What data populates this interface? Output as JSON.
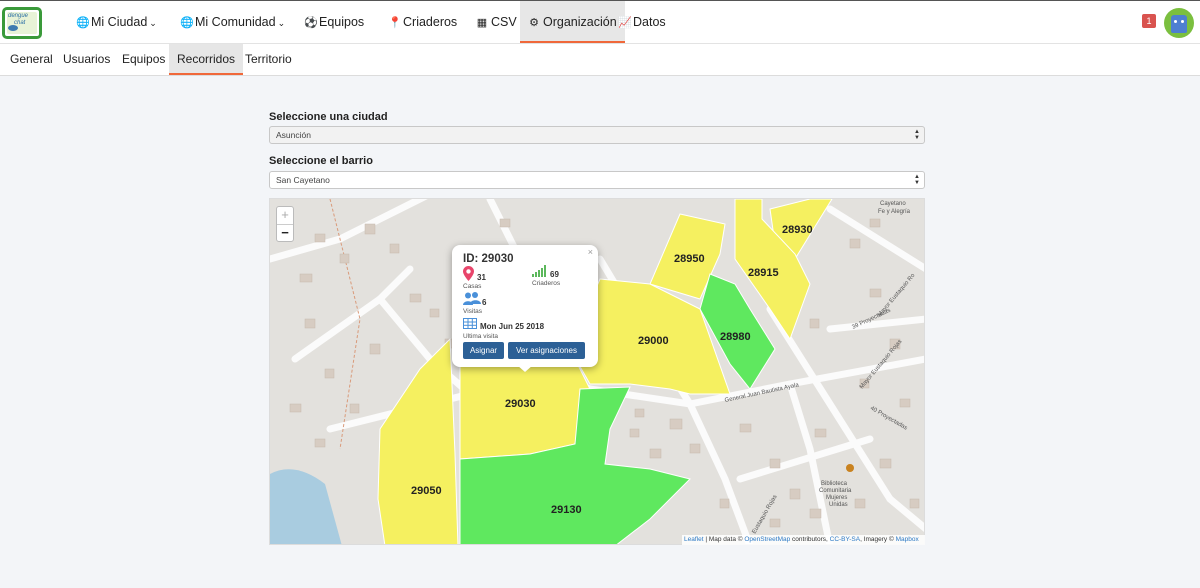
{
  "app": {
    "logo_line1": "dengue",
    "logo_line2": "chat"
  },
  "nav": {
    "mi_ciudad": "Mi Ciudad",
    "mi_comunidad": "Mi Comunidad",
    "equipos": "Equipos",
    "criaderos": "Criaderos",
    "csv": "CSV",
    "organizacion": "Organización",
    "datos": "Datos",
    "notification_count": "1"
  },
  "subnav": {
    "general": "General",
    "usuarios": "Usuarios",
    "equipos": "Equipos",
    "recorridos": "Recorridos",
    "territorio": "Territorio"
  },
  "form": {
    "city_label": "Seleccione una ciudad",
    "city_value": "Asunción",
    "barrio_label": "Seleccione el barrio",
    "barrio_value": "San Cayetano"
  },
  "map": {
    "zoom_in": "+",
    "zoom_out": "−",
    "streets": {
      "general_juan": "General Juan Bautista Ayala",
      "proyectadas_39": "39 Proyectadas",
      "mayor_eustaquio_1": "Mayor Eustaquio Ro",
      "mayor_eustaquio_2": "Mayor Eustaquio Rojas",
      "proyectadas_40": "40 Proyectadas",
      "eustaquio_rojas": "Eustaquio Rojas",
      "cayetano": "Cayetano",
      "fe_y_alegria": "Fe y Alegría",
      "biblioteca_1": "Biblioteca",
      "biblioteca_2": "Comunitaria",
      "biblioteca_3": "Mujeres",
      "biblioteca_4": "Unidas"
    },
    "zones": [
      {
        "id": "28930",
        "color": "#f5f060"
      },
      {
        "id": "28950",
        "color": "#f5f060"
      },
      {
        "id": "28915",
        "color": "#f5f060"
      },
      {
        "id": "28980",
        "color": "#5fe85f"
      },
      {
        "id": "29000",
        "color": "#f5f060"
      },
      {
        "id": "29030",
        "color": "#f5f060"
      },
      {
        "id": "29050",
        "color": "#f5f060"
      },
      {
        "id": "29130",
        "color": "#5fe85f"
      }
    ],
    "attribution": {
      "leaflet": "Leaflet",
      "part1": " | Map data © ",
      "osm": "OpenStreetMap",
      "part2": " contributors, ",
      "ccbysa": "CC-BY-SA",
      "part3": ", Imagery © ",
      "mapbox": "Mapbox"
    }
  },
  "popup": {
    "title": "ID: 29030",
    "casas_value": "31",
    "casas_label": "Casas",
    "criaderos_value": "69",
    "criaderos_label": "Criaderos",
    "visitas_value": "6",
    "visitas_label": "Visitas",
    "date_value": "Mon Jun 25 2018",
    "date_label": "Ultima visita",
    "btn_asignar": "Asignar",
    "btn_ver": "Ver asignaciones",
    "close": "×"
  },
  "colors": {
    "accent": "#f0683a",
    "zone_yellow": "#f5f060",
    "zone_green": "#5fe85f",
    "button_blue": "#2c6096",
    "badge_red": "#d9534f"
  }
}
